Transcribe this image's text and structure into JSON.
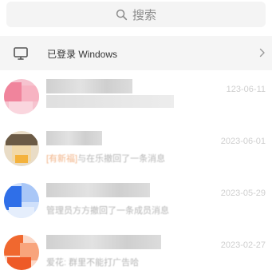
{
  "search": {
    "label": "搜索",
    "icon": "search-icon"
  },
  "login_bar": {
    "label": "已登录 Windows",
    "icon": "monitor-icon",
    "chevron": "chevron-right-icon"
  },
  "chats": [
    {
      "date": "123-06-11",
      "preview": "",
      "avatar_color": "#f08aa0"
    },
    {
      "date": "2023-06-01",
      "preview_tag": "[有新福]",
      "preview": "与在乐撤回了一条消息",
      "avatar_color": "#b08a5a"
    },
    {
      "date": "2023-05-29",
      "preview": "管理员方方撤回了一条成员消息",
      "avatar_color": "#3b82f0"
    },
    {
      "date": "2023-02-27",
      "preview": "爱花: 群里不能打广告哈",
      "avatar_color": "#f06a3a"
    }
  ],
  "colors": {
    "search_bg": "#f4f4f4",
    "login_bar_bg": "#f5f5f5",
    "date_text": "#cfcfcf",
    "preview_text": "#b5b5b5"
  }
}
